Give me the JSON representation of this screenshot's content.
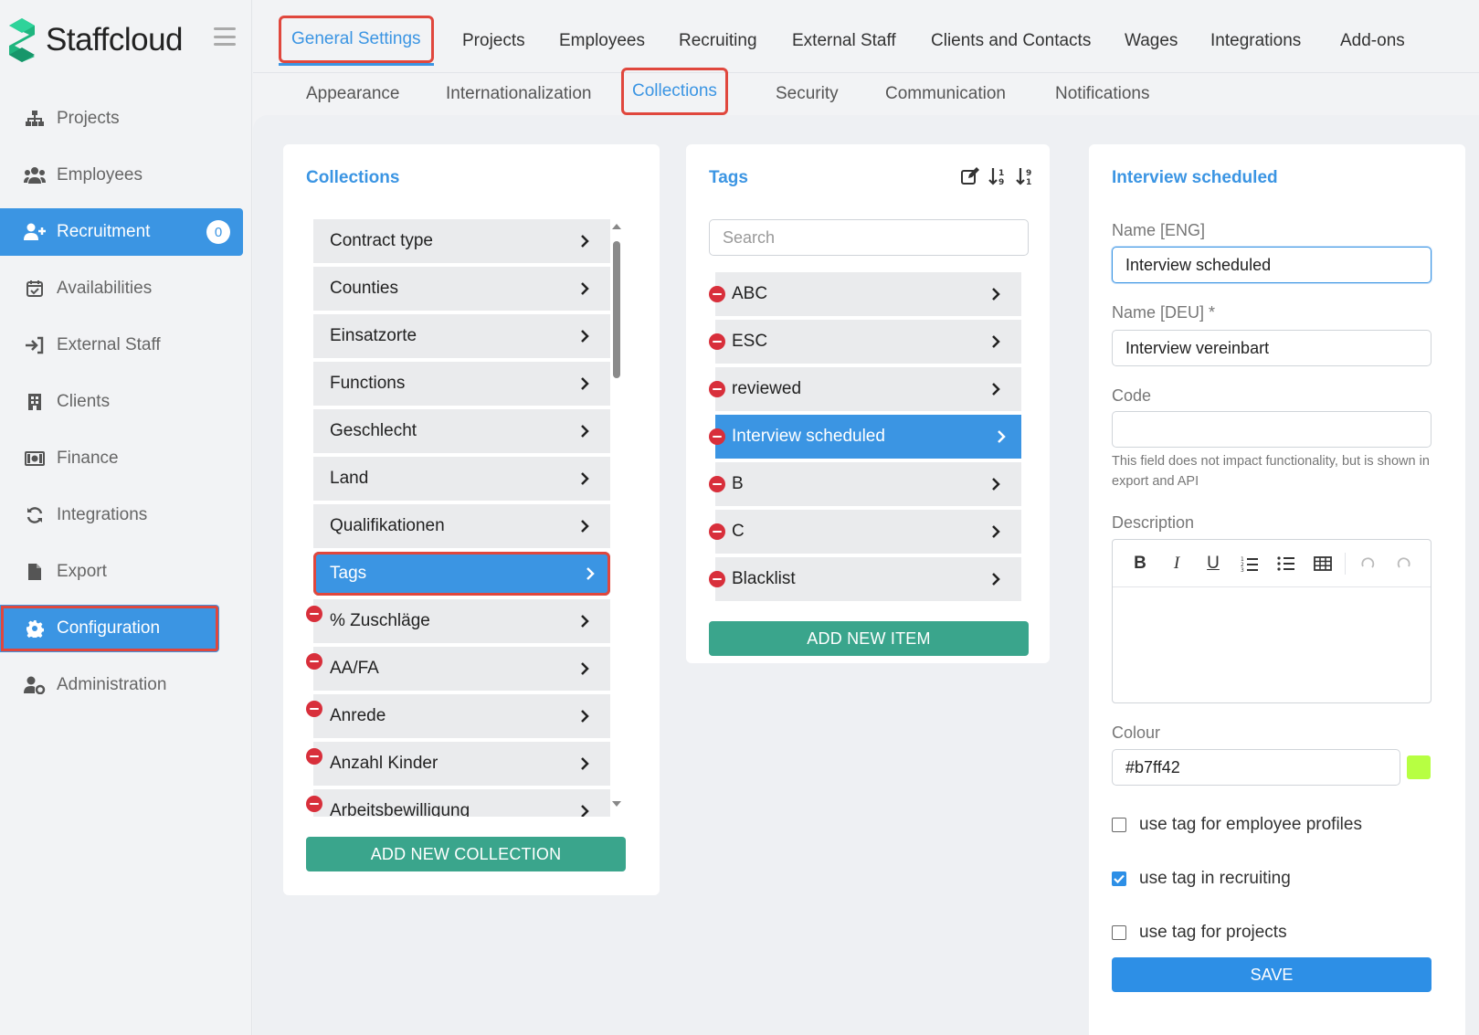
{
  "app": {
    "name": "Staffcloud"
  },
  "sidebar": {
    "items": [
      {
        "label": "Projects",
        "icon": "sitemap-icon"
      },
      {
        "label": "Employees",
        "icon": "users-icon"
      },
      {
        "label": "Recruitment",
        "icon": "user-plus-icon",
        "badge": "0"
      },
      {
        "label": "Availabilities",
        "icon": "calendar-check-icon"
      },
      {
        "label": "External Staff",
        "icon": "sign-in-icon"
      },
      {
        "label": "Clients",
        "icon": "building-icon"
      },
      {
        "label": "Finance",
        "icon": "money-icon"
      },
      {
        "label": "Integrations",
        "icon": "sync-icon"
      },
      {
        "label": "Export",
        "icon": "file-icon"
      },
      {
        "label": "Configuration",
        "icon": "gear-icon"
      },
      {
        "label": "Administration",
        "icon": "user-cog-icon"
      }
    ]
  },
  "top_tabs": [
    "General Settings",
    "Projects",
    "Employees",
    "Recruiting",
    "External Staff",
    "Clients and Contacts",
    "Wages",
    "Integrations",
    "Add-ons"
  ],
  "sub_tabs": [
    "Appearance",
    "Internationalization",
    "Collections",
    "Security",
    "Communication",
    "Notifications"
  ],
  "collections": {
    "title": "Collections",
    "items": [
      "Contract type",
      "Counties",
      "Einsatzorte",
      "Functions",
      "Geschlecht",
      "Land",
      "Qualifikationen",
      "Tags",
      "% Zuschläge",
      "AA/FA",
      "Anrede",
      "Anzahl Kinder",
      "Arbeitsbewilligung"
    ],
    "selected": "Tags",
    "add_button": "ADD NEW COLLECTION"
  },
  "tags": {
    "title": "Tags",
    "search_placeholder": "Search",
    "items": [
      "ABC",
      "ESC",
      "reviewed",
      "Interview scheduled",
      "B",
      "C",
      "Blacklist"
    ],
    "selected": "Interview scheduled",
    "add_button": "ADD NEW ITEM"
  },
  "detail": {
    "title": "Interview scheduled",
    "name_eng_label": "Name [ENG]",
    "name_eng_value": "Interview scheduled",
    "name_deu_label": "Name [DEU] *",
    "name_deu_value": "Interview vereinbart",
    "code_label": "Code",
    "code_value": "",
    "code_hint": "This field does not impact functionality, but is shown in export and API",
    "description_label": "Description",
    "colour_label": "Colour",
    "colour_value": "#b7ff42",
    "checkboxes": [
      {
        "label": "use tag for employee profiles",
        "checked": false
      },
      {
        "label": "use tag in recruiting",
        "checked": true
      },
      {
        "label": "use tag for projects",
        "checked": false
      }
    ],
    "save_button": "SAVE"
  },
  "colors": {
    "accent": "#3b95e3",
    "green": "#3aa58c",
    "danger": "#d82f3b",
    "highlight": "#e0473d",
    "swatch": "#b7ff42"
  }
}
